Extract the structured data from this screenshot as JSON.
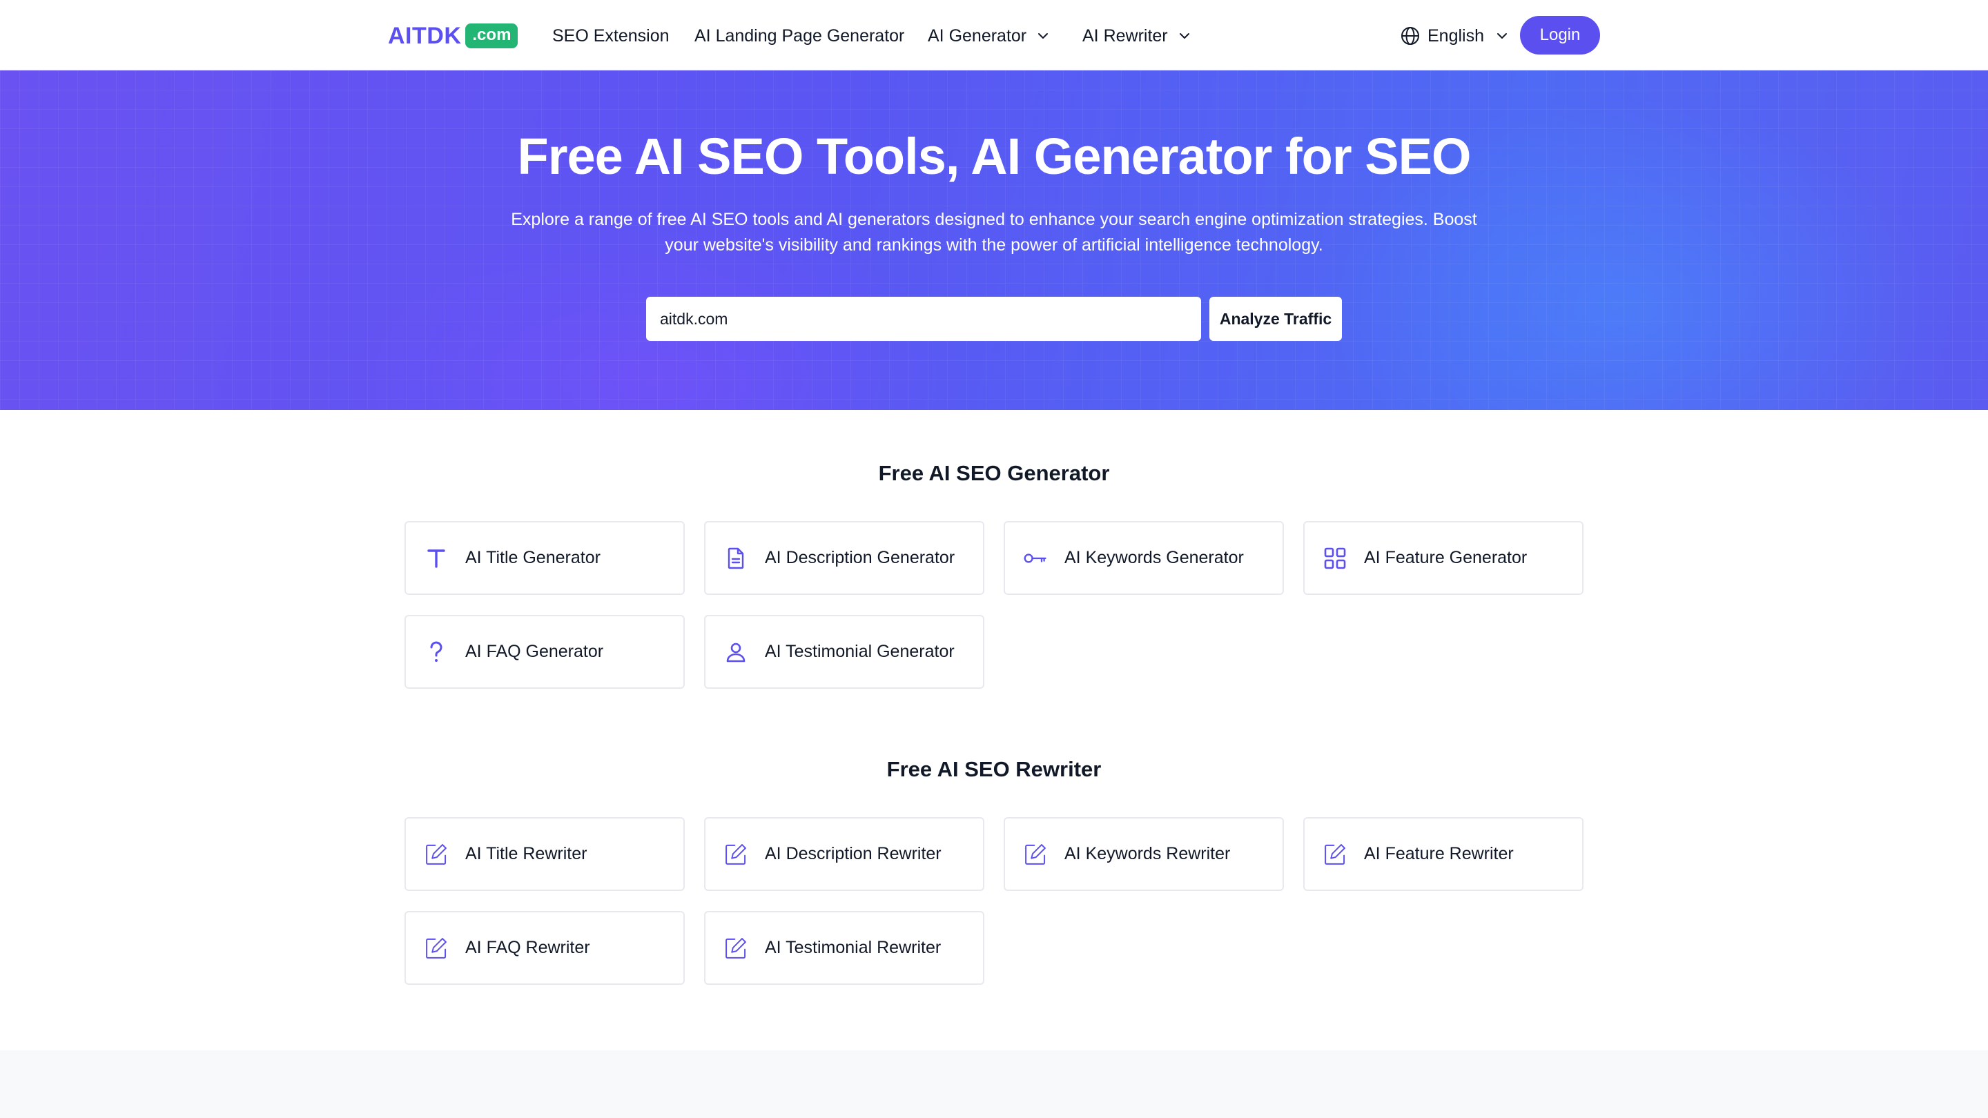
{
  "header": {
    "logo_text": "AITDK",
    "logo_badge": ".com",
    "nav": [
      {
        "label": "SEO Extension",
        "has_dropdown": false
      },
      {
        "label": "AI Landing Page Generator",
        "has_dropdown": false
      },
      {
        "label": "AI Generator",
        "has_dropdown": true
      },
      {
        "label": "AI Rewriter",
        "has_dropdown": true
      }
    ],
    "language": "English",
    "login_label": "Login"
  },
  "hero": {
    "title": "Free AI SEO Tools, AI Generator for SEO",
    "subtitle": "Explore a range of free AI SEO tools and AI generators designed to enhance your search engine optimization strategies. Boost your website's visibility and rankings with the power of artificial intelligence technology.",
    "search_value": "aitdk.com",
    "analyze_label": "Analyze Traffic"
  },
  "generator_section": {
    "title": "Free AI SEO Generator",
    "cards": [
      {
        "label": "AI Title Generator",
        "icon": "text-t-icon"
      },
      {
        "label": "AI Description Generator",
        "icon": "document-icon"
      },
      {
        "label": "AI Keywords Generator",
        "icon": "key-icon"
      },
      {
        "label": "AI Feature Generator",
        "icon": "grid-icon"
      },
      {
        "label": "AI FAQ Generator",
        "icon": "question-icon"
      },
      {
        "label": "AI Testimonial Generator",
        "icon": "user-icon"
      }
    ]
  },
  "rewriter_section": {
    "title": "Free AI SEO Rewriter",
    "cards": [
      {
        "label": "AI Title Rewriter",
        "icon": "edit-icon"
      },
      {
        "label": "AI Description Rewriter",
        "icon": "edit-icon"
      },
      {
        "label": "AI Keywords Rewriter",
        "icon": "edit-icon"
      },
      {
        "label": "AI Feature Rewriter",
        "icon": "edit-icon"
      },
      {
        "label": "AI FAQ Rewriter",
        "icon": "edit-icon"
      },
      {
        "label": "AI Testimonial Rewriter",
        "icon": "edit-icon"
      }
    ]
  },
  "colors": {
    "brand": "#5b4ff0",
    "badge": "#22b573",
    "icon": "#5b4ff0"
  }
}
